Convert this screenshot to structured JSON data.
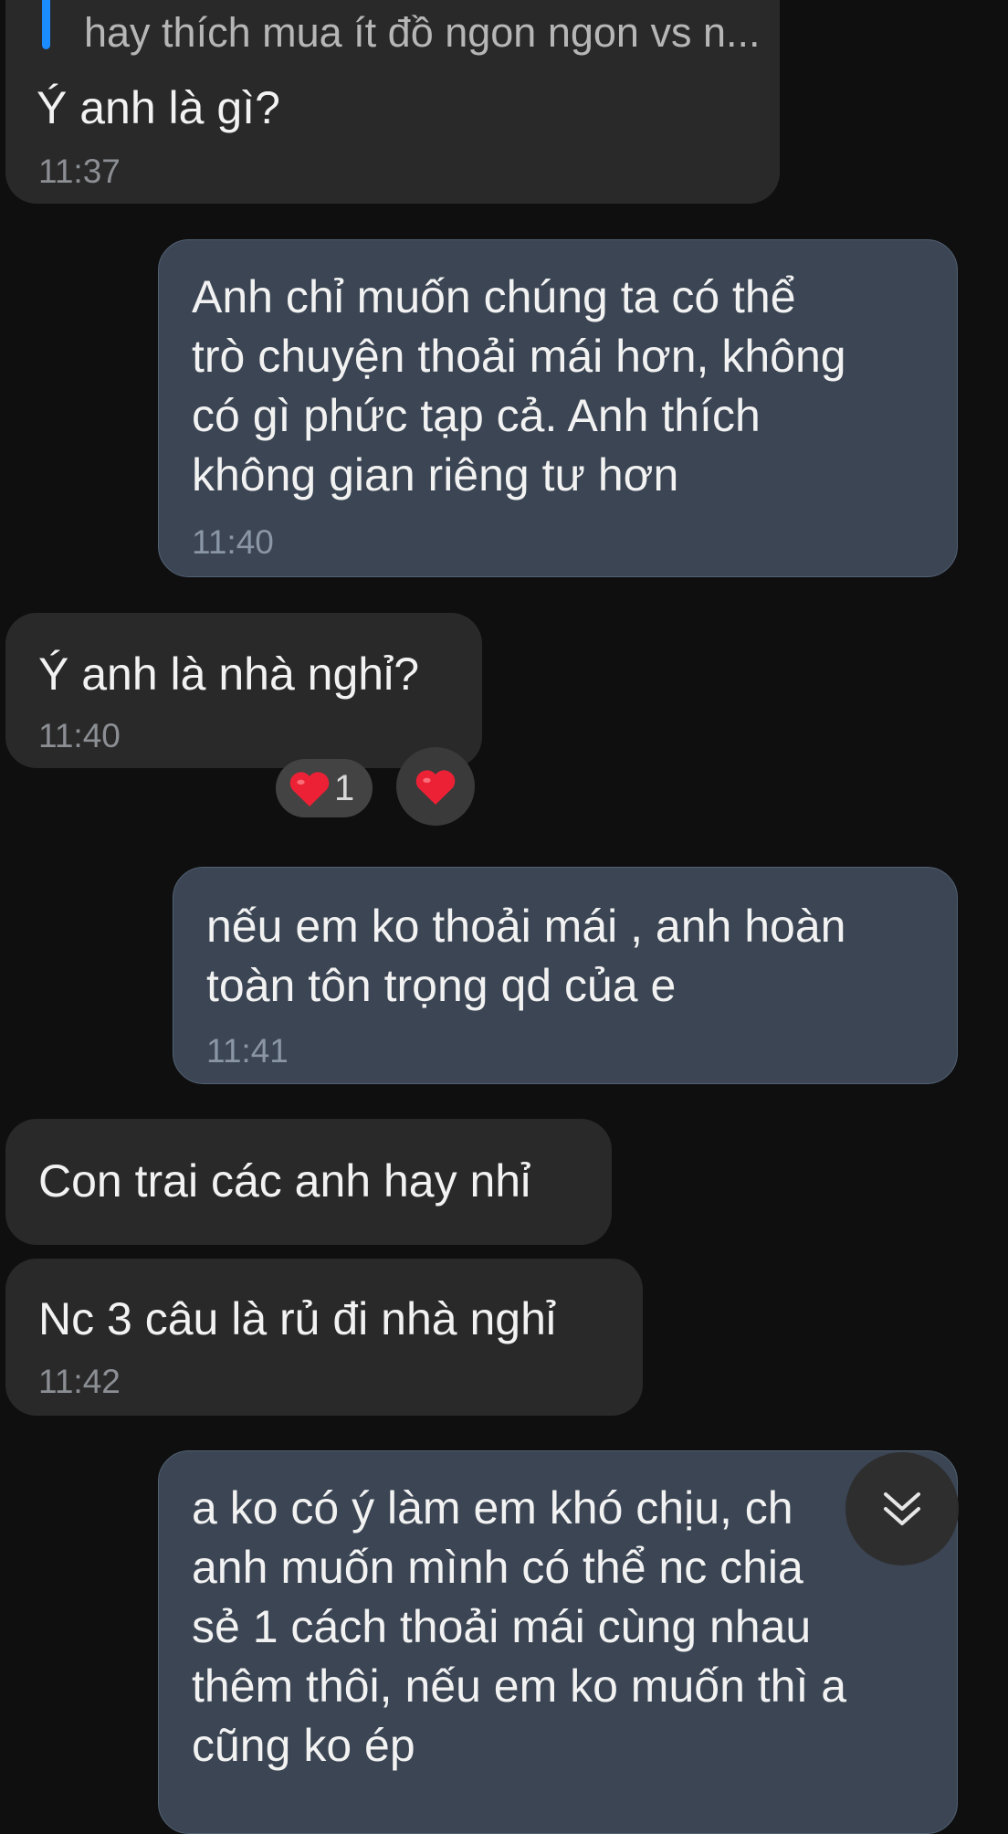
{
  "reply_preview": {
    "quoted_text": "hay thích mua ít đồ ngon ngon vs n..."
  },
  "messages": [
    {
      "direction": "incoming",
      "text": "Ý anh là gì?",
      "time": "11:37"
    },
    {
      "direction": "outgoing",
      "text": "Anh chỉ muốn chúng ta có thể\ntrò chuyện thoải mái hơn, không\ncó gì phức tạp cả. Anh thích\nkhông gian riêng tư hơn",
      "time": "11:40"
    },
    {
      "direction": "incoming",
      "text": "Ý anh là nhà nghỉ?",
      "time": "11:40",
      "reactions": {
        "summary_icon": "red-heart-icon",
        "summary_count": "1",
        "add_icon": "red-heart-icon"
      }
    },
    {
      "direction": "outgoing",
      "text": "nếu em ko thoải mái , anh hoàn\ntoàn tôn trọng qd của e",
      "time": "11:41"
    },
    {
      "direction": "incoming",
      "text": "Con trai các anh hay nhỉ",
      "time": ""
    },
    {
      "direction": "incoming",
      "text": "Nc 3 câu là rủ đi nhà nghỉ",
      "time": "11:42"
    },
    {
      "direction": "outgoing",
      "text": "a ko có ý làm em khó chịu, ch\nanh muốn mình có thể nc chia\nsẻ 1 cách thoải mái cùng nhau\nthêm thôi, nếu em ko muốn thì a\ncũng ko ép",
      "time": ""
    }
  ],
  "scroll_down_button": {
    "icon": "double-chevron-down-icon"
  },
  "colors": {
    "background": "#0f0f0f",
    "incoming_bubble": "#292929",
    "outgoing_bubble": "#3b4553",
    "reply_accent": "#1b8cff",
    "heart": "#ec2135"
  }
}
